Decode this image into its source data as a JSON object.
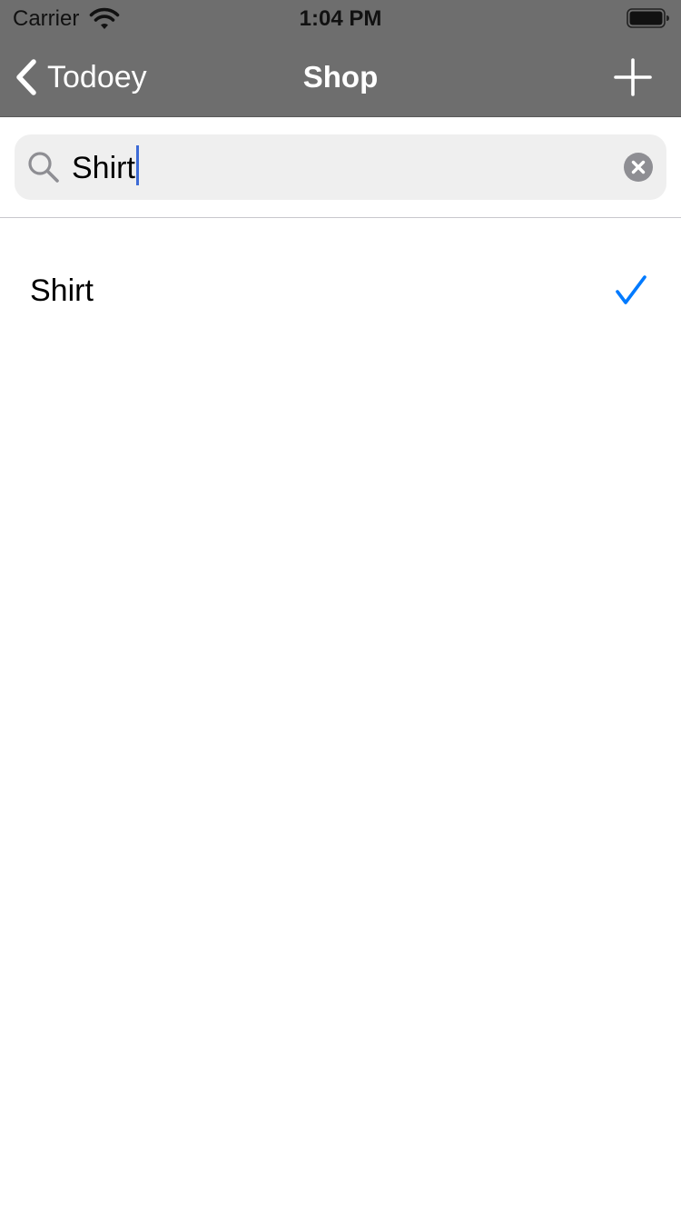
{
  "status_bar": {
    "carrier": "Carrier",
    "time": "1:04 PM",
    "wifi_icon": "wifi-icon",
    "battery_icon": "battery-icon"
  },
  "nav": {
    "back_label": "Todoey",
    "title": "Shop",
    "add_icon": "plus-icon",
    "background_color": "#6e6e6e"
  },
  "search": {
    "value": "Shirt",
    "search_icon": "magnifying-glass-icon",
    "clear_icon": "clear-circle-icon",
    "caret_color": "#3d6bd6"
  },
  "items": [
    {
      "title": "Shirt",
      "done": true
    }
  ],
  "colors": {
    "accent": "#007aff"
  }
}
